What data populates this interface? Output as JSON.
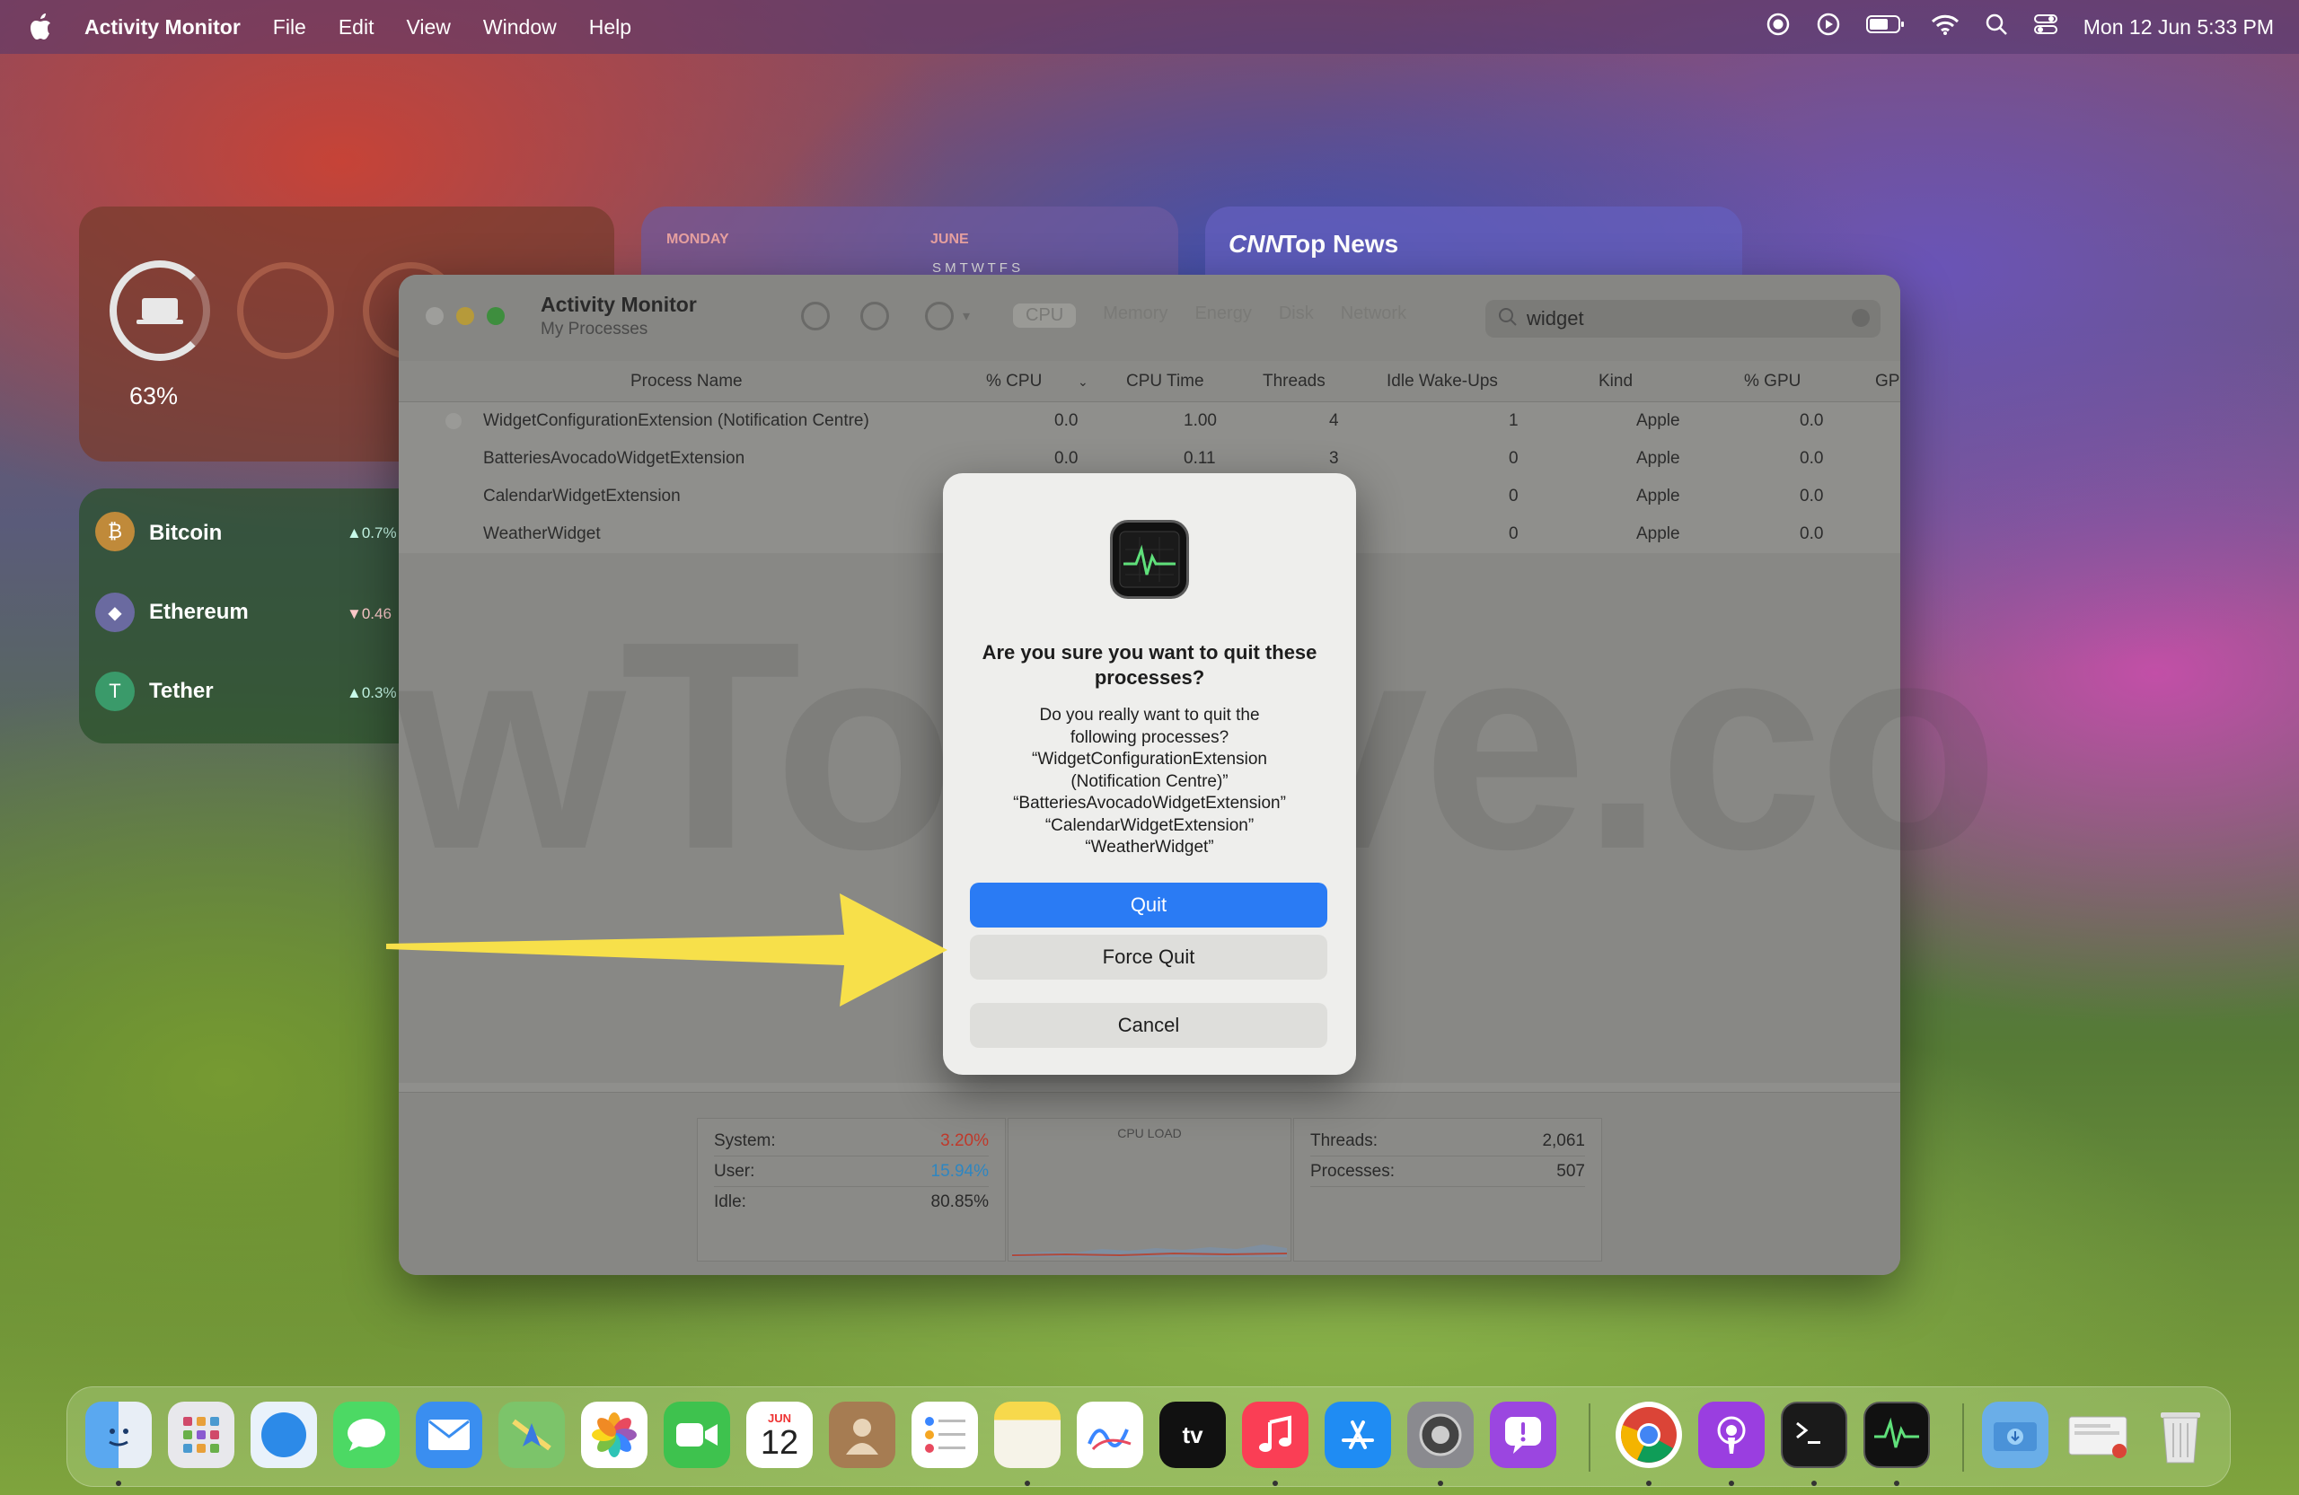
{
  "menubar": {
    "app_name": "Activity Monitor",
    "menus": [
      "File",
      "Edit",
      "View",
      "Window",
      "Help"
    ],
    "clock": "Mon 12 Jun  5:33 PM"
  },
  "widgets": {
    "battery": {
      "percent": "63%"
    },
    "calendar": {
      "day_label": "MONDAY",
      "month_label": "JUNE",
      "weekdays": "S  M  T  W  T  F  S"
    },
    "news": {
      "brand": "CNN",
      "title": "Top News"
    },
    "crypto": [
      {
        "name": "Bitcoin",
        "change": "▲0.7%",
        "symbol": "₿",
        "color": "#c08a3a"
      },
      {
        "name": "Ethereum",
        "change": "▼0.46",
        "symbol": "◆",
        "color": "#6a6aa0"
      },
      {
        "name": "Tether",
        "change": "▲0.3%",
        "symbol": "T",
        "color": "#3a9a6a"
      }
    ]
  },
  "window": {
    "title": "Activity Monitor",
    "subtitle": "My Processes",
    "tabs": [
      "CPU",
      "Memory",
      "Energy",
      "Disk",
      "Network"
    ],
    "search_value": "widget",
    "columns": [
      "Process Name",
      "% CPU",
      "CPU Time",
      "Threads",
      "Idle Wake-Ups",
      "Kind",
      "% GPU",
      "GP"
    ],
    "rows": [
      {
        "name": "WidgetConfigurationExtension (Notification Centre)",
        "cpu": "0.0",
        "cpu_time": "1.00",
        "threads": "4",
        "idle": "1",
        "kind": "Apple",
        "gpu": "0.0"
      },
      {
        "name": "BatteriesAvocadoWidgetExtension",
        "cpu": "0.0",
        "cpu_time": "0.11",
        "threads": "3",
        "idle": "0",
        "kind": "Apple",
        "gpu": "0.0"
      },
      {
        "name": "CalendarWidgetExtension",
        "cpu": "",
        "cpu_time": "",
        "threads": "",
        "idle": "0",
        "kind": "Apple",
        "gpu": "0.0"
      },
      {
        "name": "WeatherWidget",
        "cpu": "",
        "cpu_time": "",
        "threads": "",
        "idle": "0",
        "kind": "Apple",
        "gpu": "0.0"
      }
    ],
    "footer": {
      "system_label": "System:",
      "system_value": "3.20%",
      "user_label": "User:",
      "user_value": "15.94%",
      "idle_label": "Idle:",
      "idle_value": "80.85%",
      "cpu_load_label": "CPU LOAD",
      "threads_label": "Threads:",
      "threads_value": "2,061",
      "processes_label": "Processes:",
      "processes_value": "507"
    }
  },
  "watermark": "wToisive.co",
  "dialog": {
    "title": "Are you sure you want to quit these processes?",
    "message_lines": [
      "Do you really want to quit the",
      "following processes?",
      "“WidgetConfigurationExtension",
      "(Notification Centre)”",
      "“BatteriesAvocadoWidgetExtension”",
      "“CalendarWidgetExtension”",
      "“WeatherWidget”"
    ],
    "quit_label": "Quit",
    "force_quit_label": "Force Quit",
    "cancel_label": "Cancel"
  },
  "dock": {
    "calendar_month": "JUN",
    "calendar_day": "12",
    "tv_label": "tv"
  },
  "colors": {
    "accent": "#2a7bf4",
    "system_value": "#c0392b",
    "user_value": "#2e86c1",
    "arrow": "#f7e04a"
  }
}
